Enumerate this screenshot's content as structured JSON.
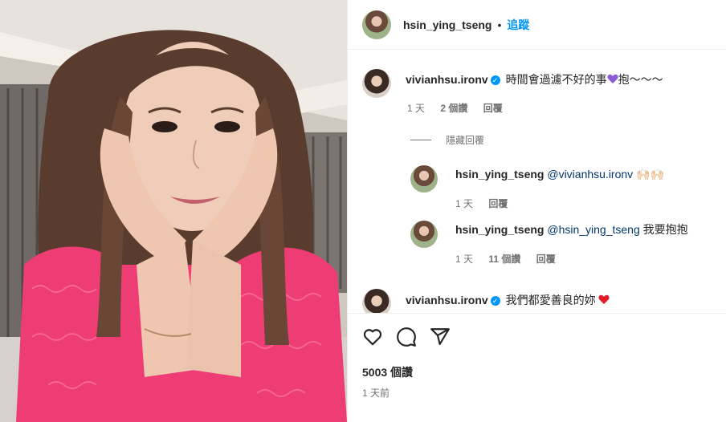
{
  "post": {
    "author": "hsin_ying_tseng",
    "follow_label": "追蹤",
    "separator": "•",
    "likes_text": "5003 個讚",
    "time_ago": "1 天前"
  },
  "comments": [
    {
      "user": "vivianhsu.ironv",
      "verified": true,
      "text_before_emoji": "時間會過濾不好的事",
      "emoji": "purple-heart",
      "text_after_emoji": "抱～～～",
      "meta": {
        "time": "1 天",
        "likes": "2 個讚",
        "reply": "回覆"
      },
      "hide_replies": "隱藏回覆",
      "replies": [
        {
          "user": "hsin_ying_tseng",
          "mention": "@vivianhsu.ironv",
          "text": "🙌🏻🙌🏻",
          "meta": {
            "time": "1 天",
            "reply": "回覆"
          }
        },
        {
          "user": "hsin_ying_tseng",
          "mention": "@hsin_ying_tseng",
          "text": "我要抱抱",
          "meta": {
            "time": "1 天",
            "likes": "11 個讚",
            "reply": "回覆"
          }
        }
      ]
    },
    {
      "user": "vivianhsu.ironv",
      "verified": true,
      "text": "我們都愛善良的妳",
      "emoji": "red-heart"
    }
  ],
  "colors": {
    "link_blue": "#0095f6",
    "mention_blue": "#00376b",
    "secondary_text": "#737373",
    "sweater_pink": "#ee3d74"
  },
  "icons": [
    "heart-icon",
    "comment-icon",
    "share-icon",
    "verified-badge-icon",
    "purple-heart-emoji",
    "red-heart-emoji"
  ]
}
